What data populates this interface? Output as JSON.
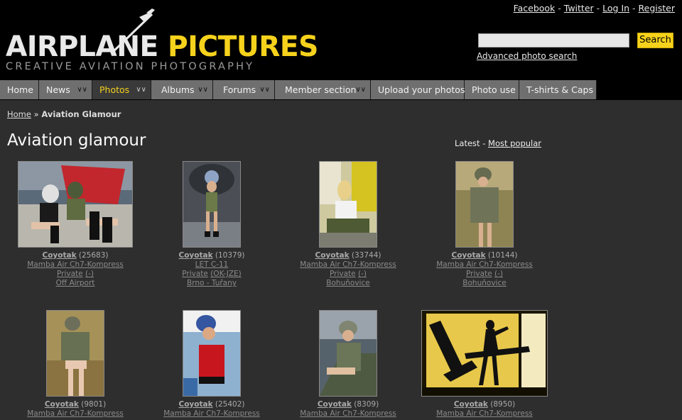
{
  "toplinks": [
    "Facebook",
    "Twitter",
    "Log In",
    "Register"
  ],
  "logo": {
    "word1": "AIRPLANE",
    "word2": "PICTURES",
    "tagline": "CREATIVE AVIATION PHOTOGRAPHY"
  },
  "search": {
    "button": "Search",
    "value": "",
    "advanced": "Advanced photo search"
  },
  "nav": [
    {
      "label": "Home",
      "dropdown": false,
      "active": false
    },
    {
      "label": "News",
      "dropdown": true,
      "active": false
    },
    {
      "label": "Photos",
      "dropdown": true,
      "active": true
    },
    {
      "label": "Albums",
      "dropdown": true,
      "active": false
    },
    {
      "label": "Forums",
      "dropdown": true,
      "active": false
    },
    {
      "label": "Member section",
      "dropdown": true,
      "active": false
    },
    {
      "label": "Upload your photos",
      "dropdown": false,
      "active": false
    },
    {
      "label": "Photo use",
      "dropdown": false,
      "active": false
    },
    {
      "label": "T-shirts & Caps",
      "dropdown": false,
      "active": false
    }
  ],
  "breadcrumb": {
    "home": "Home",
    "sep": "»",
    "current": "Aviation Glamour"
  },
  "page_title": "Aviation glamour",
  "sort": {
    "latest": "Latest",
    "sep": "-",
    "popular": "Most popular"
  },
  "photos": [
    {
      "author": "Coyotak",
      "count": "(25683)",
      "aircraft": "Mamba Air Ch7-Kompress",
      "reg": "Private",
      "regcode": "(-)",
      "location": "Off Airport"
    },
    {
      "author": "Coyotak",
      "count": "(10379)",
      "aircraft": "LET C-11",
      "reg": "Private",
      "regcode": "(OK-JZE)",
      "location": "Brno - Tuřany"
    },
    {
      "author": "Coyotak",
      "count": "(33744)",
      "aircraft": "Mamba Air Ch7-Kompress",
      "reg": "Private",
      "regcode": "(-)",
      "location": "Bohuňovice"
    },
    {
      "author": "Coyotak",
      "count": "(10144)",
      "aircraft": "Mamba Air Ch7-Kompress",
      "reg": "Private",
      "regcode": "(-)",
      "location": "Bohuňovice"
    },
    {
      "author": "Coyotak",
      "count": "(9801)",
      "aircraft": "Mamba Air Ch7-Kompress",
      "reg": "",
      "regcode": "",
      "location": ""
    },
    {
      "author": "Coyotak",
      "count": "(25402)",
      "aircraft": "Mamba Air Ch7-Kompress",
      "reg": "",
      "regcode": "",
      "location": ""
    },
    {
      "author": "Coyotak",
      "count": "(8309)",
      "aircraft": "Mamba Air Ch7-Kompress",
      "reg": "",
      "regcode": "",
      "location": ""
    },
    {
      "author": "Coyotak",
      "count": "(8950)",
      "aircraft": "Mamba Air Ch7-Kompress",
      "reg": "",
      "regcode": "",
      "location": ""
    }
  ]
}
